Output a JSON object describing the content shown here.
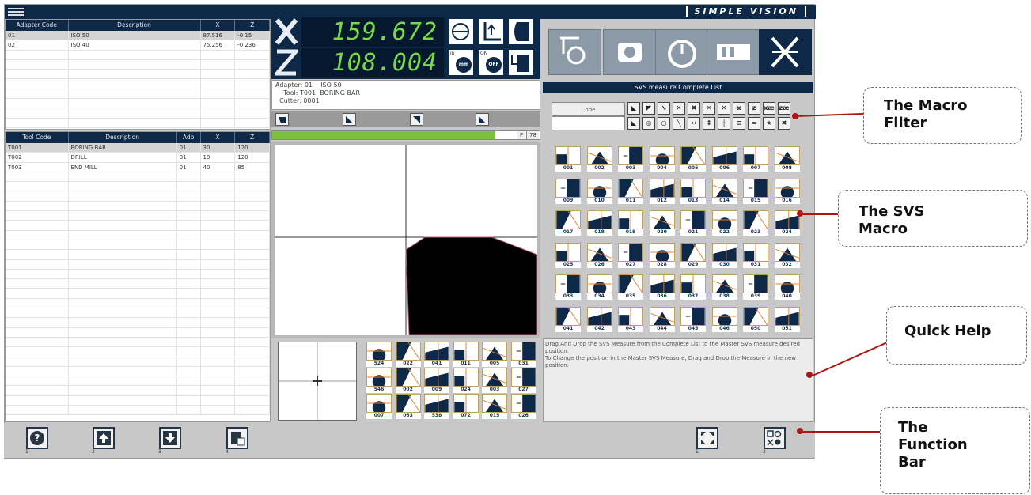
{
  "app": {
    "brand": "SIMPLE VISION"
  },
  "adapters": {
    "headers": [
      "Adapter Code",
      "Description",
      "X",
      "Z"
    ],
    "rows": [
      [
        "01",
        "ISO 50",
        "87.516",
        "-0.15"
      ],
      [
        "02",
        "ISO 40",
        "75.256",
        "-0.236"
      ]
    ]
  },
  "tools": {
    "headers": [
      "Tool Code",
      "Description",
      "Adp",
      "X",
      "Z"
    ],
    "rows": [
      [
        "T001",
        "BORING BAR",
        "01",
        "30",
        "120"
      ],
      [
        "T002",
        "DRILL",
        "01",
        "10",
        "120"
      ],
      [
        "T003",
        "END MILL",
        "01",
        "40",
        "85"
      ]
    ]
  },
  "dro": {
    "x_value": "159.672",
    "z_value": "108.004",
    "in_label": "in",
    "mm_label": "mm",
    "on_label": "ON",
    "off_label": "OFF"
  },
  "info": {
    "adapter_line": "Adapter: 01    ISO 50",
    "tool_line": "    Tool: T001  BORING BAR",
    "cutter_line": "  Cutter: 0001"
  },
  "progress": {
    "f_label": "F",
    "value_label": "78",
    "fraction": 0.92
  },
  "svs_list": {
    "title": "SVS measure Complete List",
    "code_label": "Code",
    "filter_x": "x",
    "filter_z": "z",
    "filter_x_lock": "xæ",
    "filter_z_lock": "zæ",
    "macros": [
      "001",
      "002",
      "003",
      "004",
      "005",
      "006",
      "007",
      "008",
      "009",
      "010",
      "011",
      "012",
      "013",
      "014",
      "015",
      "016",
      "017",
      "018",
      "019",
      "020",
      "021",
      "022",
      "023",
      "024",
      "025",
      "026",
      "027",
      "028",
      "029",
      "030",
      "031",
      "032",
      "033",
      "034",
      "035",
      "036",
      "037",
      "038",
      "039",
      "040",
      "041",
      "042",
      "043",
      "044",
      "045",
      "046",
      "050",
      "051"
    ]
  },
  "master": {
    "macros": [
      "524",
      "022",
      "041",
      "011",
      "005",
      "031",
      "546",
      "002",
      "009",
      "024",
      "003",
      "027",
      "007",
      "063",
      "538",
      "072",
      "015",
      "026"
    ]
  },
  "help": {
    "line1": "Drag And Drop the SVS Measure from the Complete List to the Master SVS measure desired position.",
    "line2": "To Change the position in the Master SVS Measure, Drag and Drop the Measure in the new position."
  },
  "function_bar": {
    "keys": [
      "1",
      "2",
      "3",
      "4",
      "1",
      "2"
    ]
  },
  "callouts": {
    "macro_filter": [
      "The Macro",
      "Filter"
    ],
    "svs_macro": [
      "The SVS",
      "Macro"
    ],
    "quick_help": [
      "Quick Help"
    ],
    "function_bar": [
      "The",
      "Function",
      "Bar"
    ]
  },
  "colors": {
    "navy": "#0e2847",
    "dro_green": "#79d84a",
    "progress_green": "#7fbf3f",
    "callout_red": "#b01515"
  }
}
